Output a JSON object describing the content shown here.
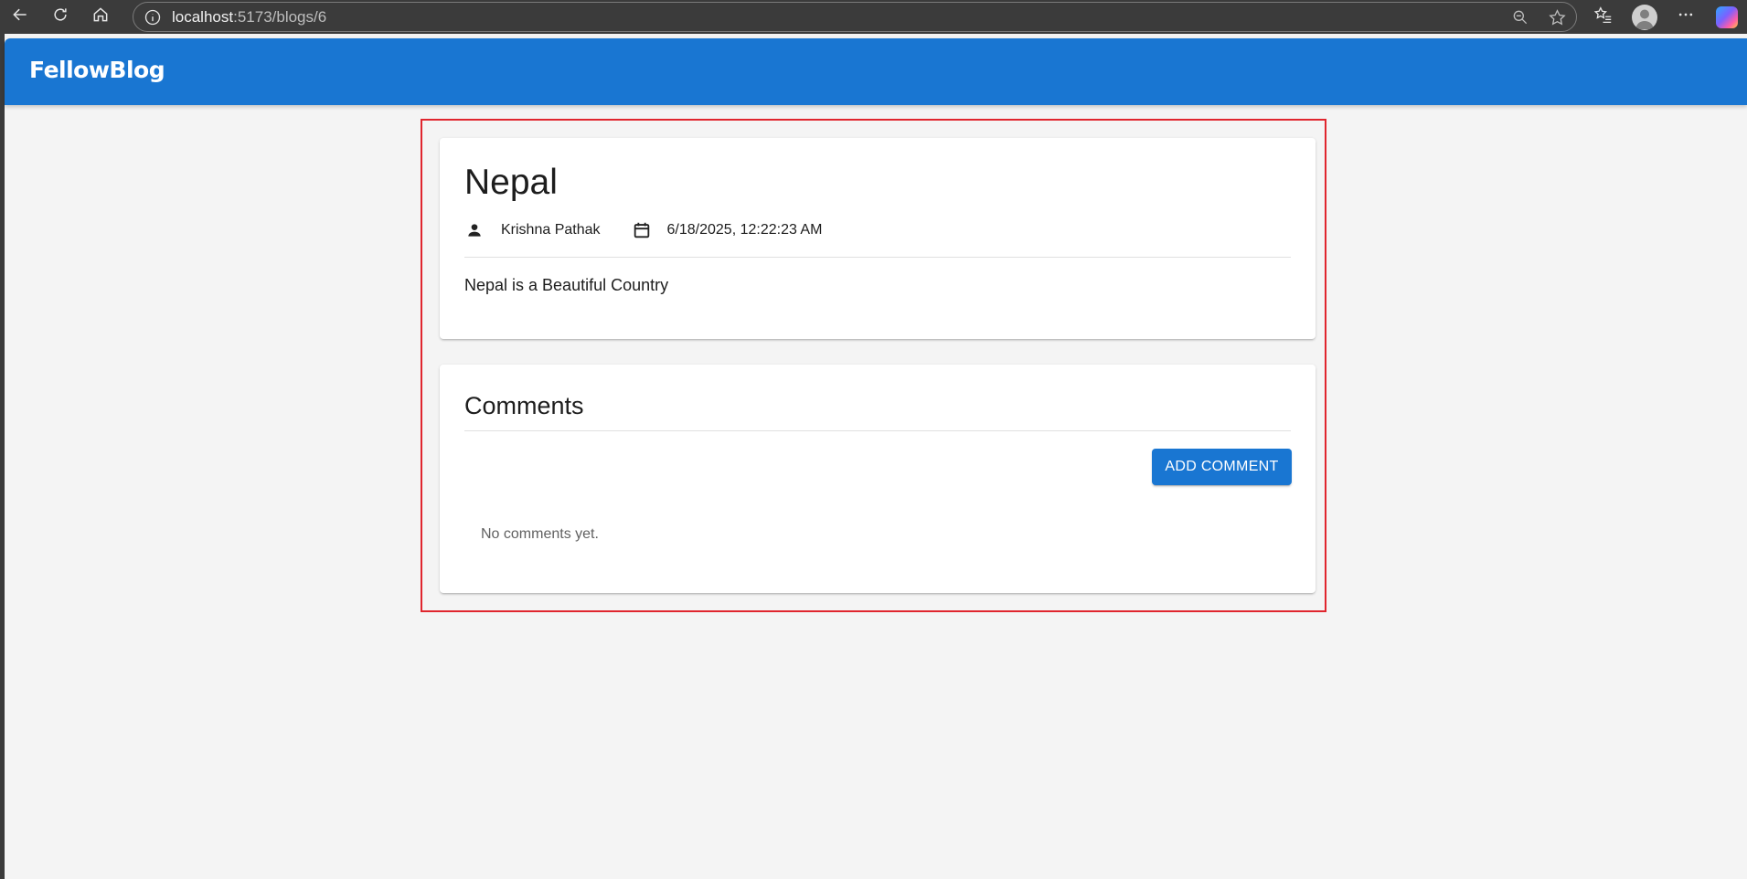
{
  "browser": {
    "url_host": "localhost",
    "url_path": ":5173/blogs/6"
  },
  "app": {
    "brand": "FellowBlog",
    "primary_color": "#1976d2"
  },
  "post": {
    "title": "Nepal",
    "author": "Krishna Pathak",
    "date": "6/18/2025, 12:22:23 AM",
    "body": "Nepal is a Beautiful Country"
  },
  "comments": {
    "title": "Comments",
    "add_label": "ADD COMMENT",
    "empty_text": "No comments yet."
  },
  "icons": {
    "back": "arrow-left-icon",
    "reload": "reload-icon",
    "home": "home-icon",
    "info": "info-icon",
    "zoom": "zoom-out-icon",
    "favorite": "star-icon",
    "favorites": "favorites-list-icon",
    "profile": "profile-icon",
    "more": "more-icon",
    "copilot": "copilot-icon",
    "author": "person-icon",
    "date": "calendar-icon"
  },
  "highlight_color": "#e0262e"
}
